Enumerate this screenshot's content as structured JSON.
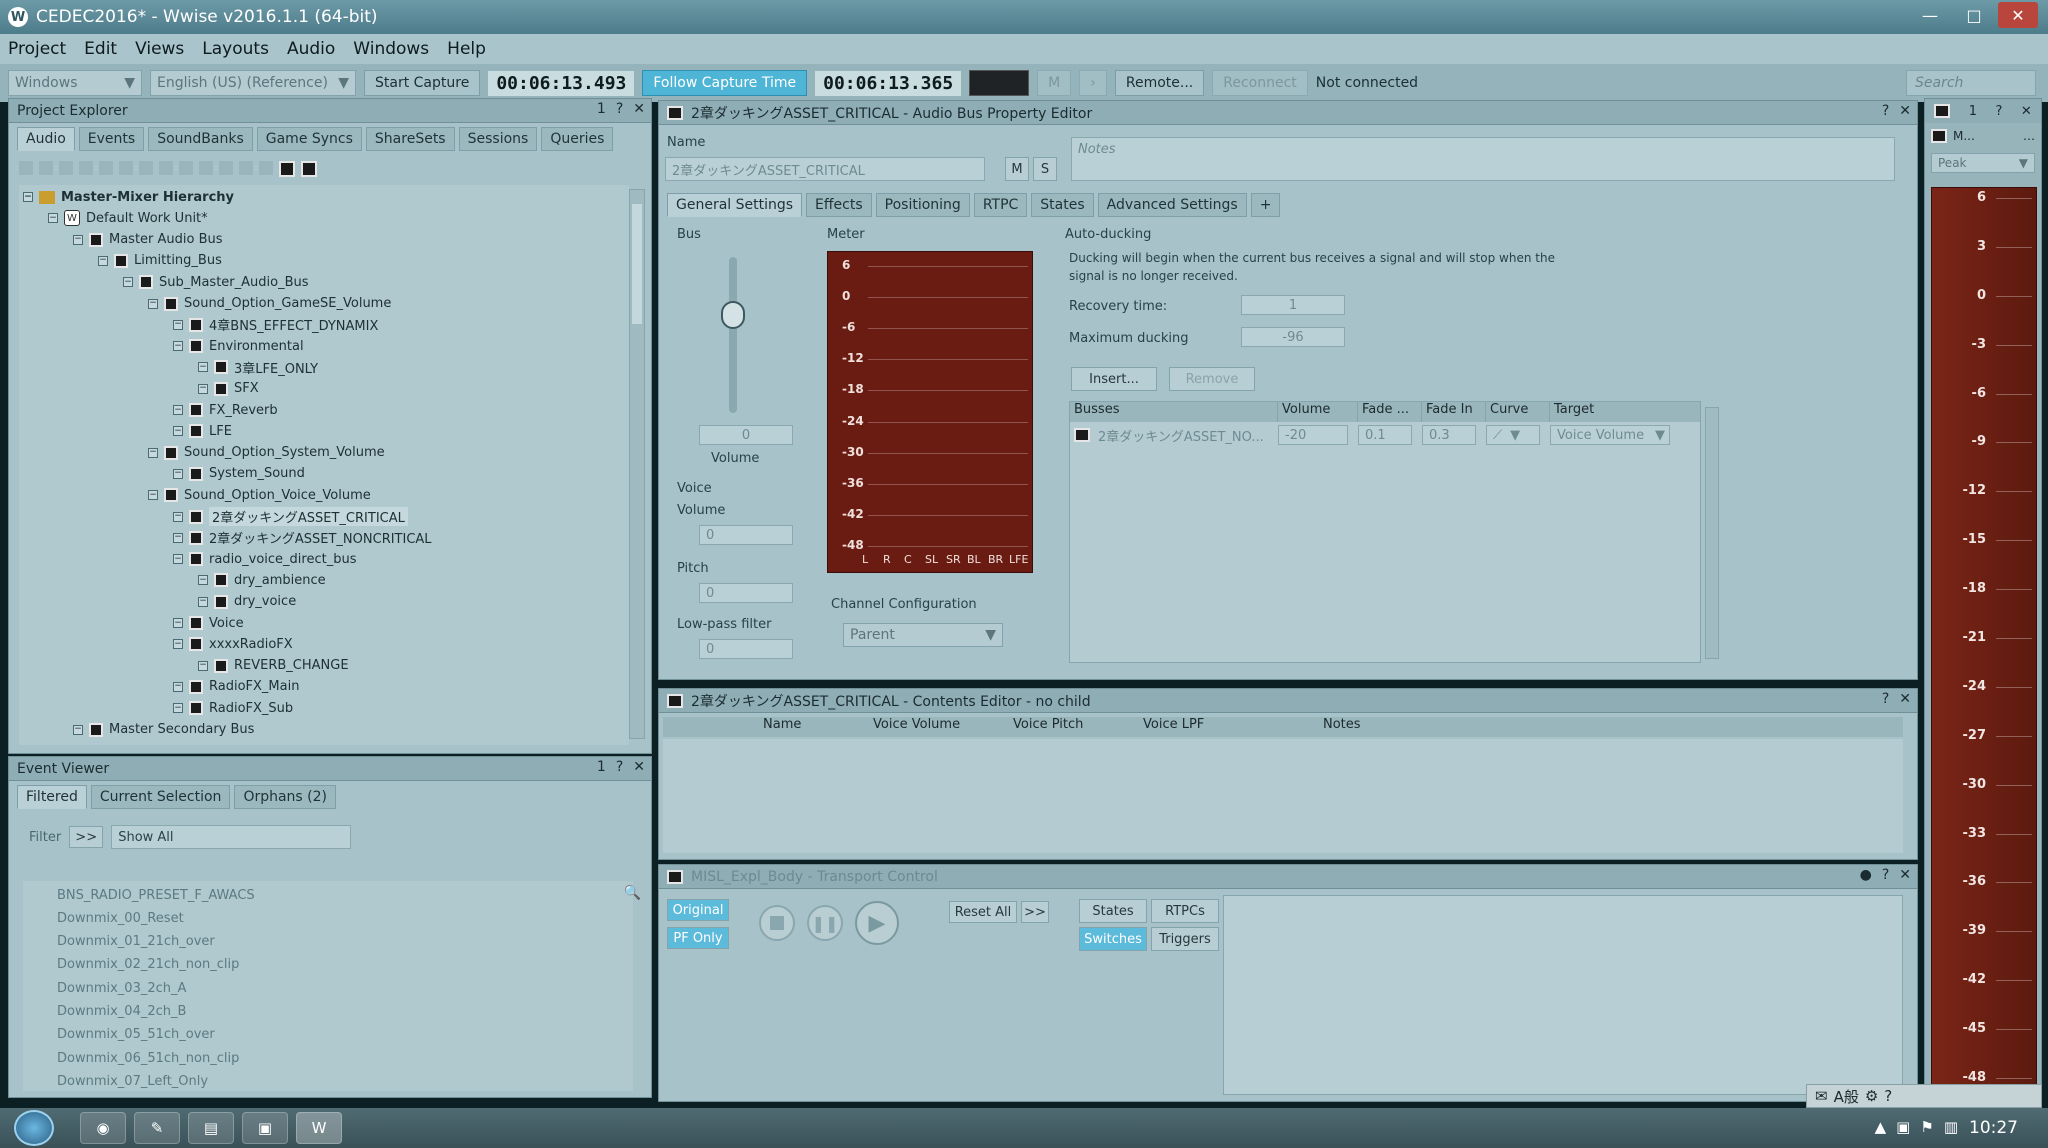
{
  "window": {
    "title": "CEDEC2016* - Wwise v2016.1.1 (64-bit)",
    "controls": [
      "—",
      "□",
      "✕"
    ]
  },
  "menu": [
    "Project",
    "Edit",
    "Views",
    "Layouts",
    "Audio",
    "Windows",
    "Help"
  ],
  "toolbar": {
    "layout_combo": "Windows",
    "language_combo": "English (US) (Reference)",
    "start_capture": "Start Capture",
    "capture_time": "00:06:13.493",
    "follow_capture": "Follow Capture Time",
    "current_time": "00:06:13.365",
    "m_label": "M",
    "remote": "Remote...",
    "reconnect": "Reconnect",
    "status": "Not connected",
    "search_placeholder": "Search"
  },
  "project_explorer": {
    "title": "Project Explorer",
    "tabs": [
      "Audio",
      "Events",
      "SoundBanks",
      "Game Syncs",
      "ShareSets",
      "Sessions",
      "Queries"
    ],
    "tree": [
      {
        "label": "Master-Mixer Hierarchy",
        "level": 0,
        "kind": "folder",
        "bold": true
      },
      {
        "label": "Default Work Unit*",
        "level": 1,
        "kind": "workunit"
      },
      {
        "label": "Master Audio Bus",
        "level": 2,
        "kind": "bus"
      },
      {
        "label": "Limitting_Bus",
        "level": 3,
        "kind": "bus"
      },
      {
        "label": "Sub_Master_Audio_Bus",
        "level": 4,
        "kind": "bus"
      },
      {
        "label": "Sound_Option_GameSE_Volume",
        "level": 5,
        "kind": "bus"
      },
      {
        "label": "4章BNS_EFFECT_DYNAMIX",
        "level": 6,
        "kind": "bus"
      },
      {
        "label": "Environmental",
        "level": 6,
        "kind": "bus"
      },
      {
        "label": "3章LFE_ONLY",
        "level": 7,
        "kind": "bus"
      },
      {
        "label": "SFX",
        "level": 7,
        "kind": "bus"
      },
      {
        "label": "FX_Reverb",
        "level": 6,
        "kind": "bus"
      },
      {
        "label": "LFE",
        "level": 6,
        "kind": "bus"
      },
      {
        "label": "Sound_Option_System_Volume",
        "level": 5,
        "kind": "bus"
      },
      {
        "label": "System_Sound",
        "level": 6,
        "kind": "bus"
      },
      {
        "label": "Sound_Option_Voice_Volume",
        "level": 5,
        "kind": "bus"
      },
      {
        "label": "2章ダッキングASSET_CRITICAL",
        "level": 6,
        "kind": "bus",
        "selected": true
      },
      {
        "label": "2章ダッキングASSET_NONCRITICAL",
        "level": 6,
        "kind": "bus"
      },
      {
        "label": "radio_voice_direct_bus",
        "level": 6,
        "kind": "bus"
      },
      {
        "label": "dry_ambience",
        "level": 7,
        "kind": "bus"
      },
      {
        "label": "dry_voice",
        "level": 7,
        "kind": "bus"
      },
      {
        "label": "Voice",
        "level": 6,
        "kind": "bus"
      },
      {
        "label": "xxxxRadioFX",
        "level": 6,
        "kind": "bus"
      },
      {
        "label": "REVERB_CHANGE",
        "level": 7,
        "kind": "bus"
      },
      {
        "label": "RadioFX_Main",
        "level": 6,
        "kind": "bus"
      },
      {
        "label": "RadioFX_Sub",
        "level": 6,
        "kind": "bus"
      },
      {
        "label": "Master Secondary Bus",
        "level": 2,
        "kind": "bus"
      }
    ]
  },
  "event_viewer": {
    "title": "Event Viewer",
    "tabs": [
      "Filtered",
      "Current Selection",
      "Orphans (2)"
    ],
    "filter_label": "Filter",
    "filter_btn": ">>",
    "filter_value": "Show All",
    "events": [
      "BNS_RADIO_PRESET_F_AWACS",
      "Downmix_00_Reset",
      "Downmix_01_21ch_over",
      "Downmix_02_21ch_non_clip",
      "Downmix_03_2ch_A",
      "Downmix_04_2ch_B",
      "Downmix_05_51ch_over",
      "Downmix_06_51ch_non_clip",
      "Downmix_07_Left_Only"
    ]
  },
  "property_editor": {
    "title": "2章ダッキングASSET_CRITICAL - Audio Bus Property Editor",
    "name_label": "Name",
    "name_value": "2章ダッキングASSET_CRITICAL",
    "m_btn": "M",
    "s_btn": "S",
    "notes_placeholder": "Notes",
    "tabs": [
      "General Settings",
      "Effects",
      "Positioning",
      "RTPC",
      "States",
      "Advanced Settings",
      "+"
    ],
    "bus_label": "Bus",
    "bus_volume_value": "0",
    "bus_volume_label": "Volume",
    "voice_label": "Voice",
    "voice_volume_label": "Volume",
    "voice_volume_value": "0",
    "pitch_label": "Pitch",
    "pitch_value": "0",
    "lpf_label": "Low-pass filter",
    "lpf_value": "0",
    "meter_label": "Meter",
    "meter_ticks": [
      "6",
      "0",
      "-6",
      "-12",
      "-18",
      "-24",
      "-30",
      "-36",
      "-42",
      "-48"
    ],
    "meter_channels": [
      "L",
      "R",
      "C",
      "SL",
      "SR",
      "BL",
      "BR",
      "LFE"
    ],
    "channel_config_label": "Channel Configuration",
    "channel_config_value": "Parent",
    "autoducking": {
      "label": "Auto-ducking",
      "description_line1": "Ducking will begin when the current bus receives a signal and will stop when the",
      "description_line2": "signal is no longer received.",
      "recovery_label": "Recovery time:",
      "recovery_value": "1",
      "max_ducking_label": "Maximum ducking",
      "max_ducking_value": "-96",
      "insert_btn": "Insert...",
      "remove_btn": "Remove",
      "columns": [
        "Busses",
        "Volume",
        "Fade ...",
        "Fade In",
        "Curve",
        "Target"
      ],
      "row": {
        "bus": "2章ダッキングASSET_NO...",
        "volume": "-20",
        "fade_out": "0.1",
        "fade_in": "0.3",
        "curve": "⟋",
        "target": "Voice Volume"
      }
    }
  },
  "contents_editor": {
    "title": "2章ダッキングASSET_CRITICAL - Contents Editor - no child",
    "columns": [
      "Name",
      "Voice Volume",
      "Voice Pitch",
      "Voice LPF",
      "Notes"
    ]
  },
  "transport": {
    "title": "MISL_Expl_Body - Transport Control",
    "original_btn": "Original",
    "pf_only_btn": "PF Only",
    "reset_all_btn": "Reset All",
    "more_btn": ">>",
    "states_btn": "States",
    "rtpcs_btn": "RTPCs",
    "switches_btn": "Switches",
    "triggers_btn": "Triggers"
  },
  "peak_meter": {
    "combo": "Peak",
    "header_m": "M...",
    "ticks": [
      "6",
      "3",
      "0",
      "-3",
      "-6",
      "-9",
      "-12",
      "-15",
      "-18",
      "-21",
      "-24",
      "-27",
      "-30",
      "-33",
      "-36",
      "-39",
      "-42",
      "-45",
      "-48"
    ]
  },
  "taskbar": {
    "ime": "A般",
    "clock": "10:27"
  },
  "colors": {
    "accent": "#4eb5d6",
    "panel": "#a7c2c9",
    "meter_bg": "#6b1c12"
  }
}
